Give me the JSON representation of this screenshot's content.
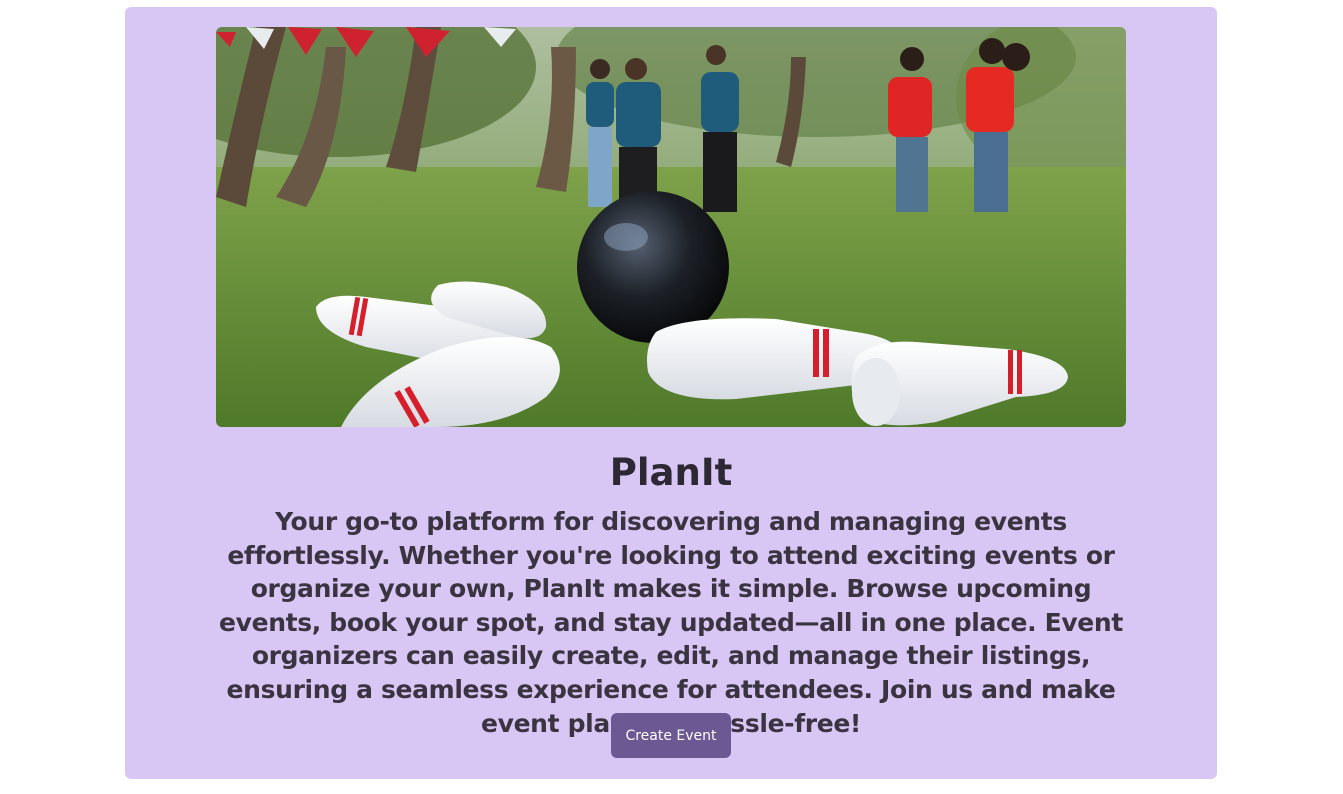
{
  "hero": {
    "image_icon": "outdoor-bowling-photo",
    "title": "PlanIt",
    "description": "Your go-to platform for discovering and managing events effortlessly. Whether you're looking to attend exciting events or organize your own, PlanIt makes it simple. Browse upcoming events, book your spot, and stay updated—all in one place. Event organizers can easily create, edit, and manage their listings, ensuring a seamless experience for attendees. Join us and make event planning hassle-free!",
    "create_button_label": "Create Event"
  },
  "colors": {
    "card_background": "#d8c6f5",
    "button_background": "#6c5893",
    "text": "#2e2834"
  }
}
